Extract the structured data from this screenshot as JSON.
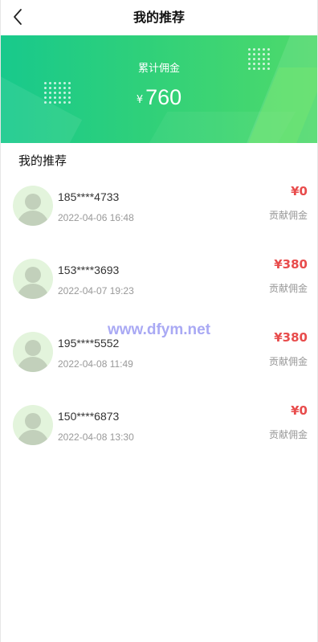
{
  "header": {
    "title": "我的推荐",
    "back_icon": "chevron-left-icon"
  },
  "banner": {
    "label": "累计佣金",
    "currency": "¥",
    "amount": "760"
  },
  "section_title": "我的推荐",
  "records": [
    {
      "phone": "185****4733",
      "time": "2022-04-06 16:48",
      "amount": "¥0",
      "label": "贡献佣金"
    },
    {
      "phone": "153****3693",
      "time": "2022-04-07 19:23",
      "amount": "¥380",
      "label": "贡献佣金"
    },
    {
      "phone": "195****5552",
      "time": "2022-04-08 11:49",
      "amount": "¥380",
      "label": "贡献佣金"
    },
    {
      "phone": "150****6873",
      "time": "2022-04-08 13:30",
      "amount": "¥0",
      "label": "贡献佣金"
    }
  ],
  "watermark": "www.dfym.net",
  "colors": {
    "banner_start": "#18c98c",
    "banner_end": "#4fda6a",
    "amount": "#e84c4c",
    "avatar_bg": "#e3f4dc"
  }
}
